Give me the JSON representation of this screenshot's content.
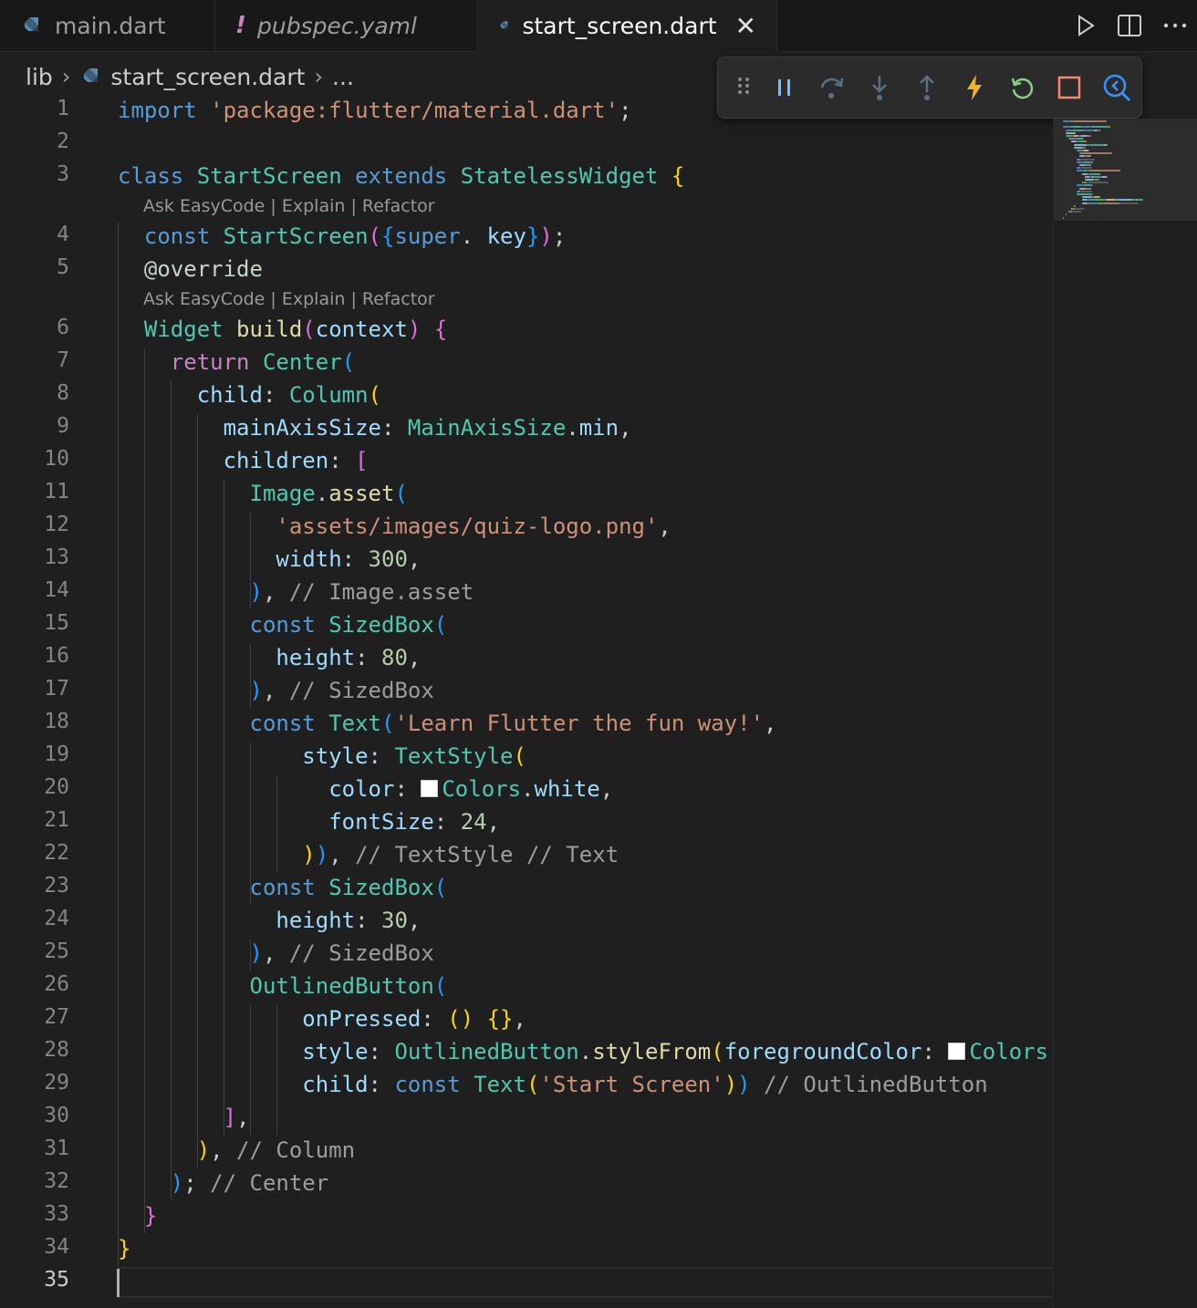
{
  "tabs": [
    {
      "label": "main.dart",
      "active": false,
      "icon": "dart-icon"
    },
    {
      "label": "pubspec.yaml",
      "active": false,
      "icon": "warning-exclamation-icon",
      "mark": "!"
    },
    {
      "label": "start_screen.dart",
      "active": true,
      "icon": "dart-icon"
    }
  ],
  "breadcrumb": {
    "folder": "lib",
    "file": "start_screen.dart",
    "ellipsis": "..."
  },
  "debug_toolbar": {
    "icons": [
      "drag-handle-icon",
      "pause-icon",
      "step-over-icon",
      "step-into-icon",
      "step-out-icon",
      "hot-reload-icon",
      "restart-icon",
      "stop-icon",
      "devtools-inspector-icon"
    ]
  },
  "editor": {
    "current_line": 35,
    "codelens_1": "Ask EasyCode | Explain | Refactor",
    "codelens_2": "Ask EasyCode | Explain | Refactor",
    "line_numbers": [
      "1",
      "2",
      "3",
      "4",
      "5",
      "6",
      "7",
      "8",
      "9",
      "10",
      "11",
      "12",
      "13",
      "14",
      "15",
      "16",
      "17",
      "18",
      "19",
      "20",
      "21",
      "22",
      "23",
      "24",
      "25",
      "26",
      "27",
      "28",
      "29",
      "30",
      "31",
      "32",
      "33",
      "34",
      "35"
    ],
    "lines": [
      [
        [
          "kw",
          "import"
        ],
        [
          "",
          "' "
        ],
        [
          "str",
          "'package:flutter/material.dart'"
        ],
        [
          "",
          ";"
        ]
      ],
      [],
      [
        [
          "kw",
          "class "
        ],
        [
          "cls",
          "StartScreen "
        ],
        [
          "kw",
          "extends "
        ],
        [
          "cls",
          "StatelessWidget "
        ],
        [
          "b1",
          "{"
        ]
      ],
      [
        [
          "kw",
          "const "
        ],
        [
          "cls",
          "StartScreen"
        ],
        [
          "b2",
          "("
        ],
        [
          "b3",
          "{"
        ],
        [
          "kw",
          "super"
        ],
        [
          "",
          ". "
        ],
        [
          "prop",
          "key"
        ],
        [
          "b3",
          "}"
        ],
        [
          "b2",
          ")"
        ],
        [
          "",
          ";"
        ]
      ],
      [
        [
          "ann",
          "@override"
        ]
      ],
      [
        [
          "cls",
          "Widget "
        ],
        [
          "fn",
          "build"
        ],
        [
          "b2",
          "("
        ],
        [
          "prop",
          "context"
        ],
        [
          "b2",
          ")"
        ],
        [
          "",
          " "
        ],
        [
          "b2",
          "{"
        ]
      ],
      [
        [
          "ctl",
          "return "
        ],
        [
          "cls",
          "Center"
        ],
        [
          "b3",
          "("
        ]
      ],
      [
        [
          "prop",
          "child"
        ],
        [
          "",
          ": "
        ],
        [
          "cls",
          "Column"
        ],
        [
          "b1",
          "("
        ]
      ],
      [
        [
          "prop",
          "mainAxisSize"
        ],
        [
          "",
          ": "
        ],
        [
          "cls",
          "MainAxisSize"
        ],
        [
          "",
          "."
        ],
        [
          "prop",
          "min"
        ],
        [
          "",
          ","
        ]
      ],
      [
        [
          "prop",
          "children"
        ],
        [
          "",
          ": "
        ],
        [
          "b2",
          "["
        ]
      ],
      [
        [
          "cls",
          "Image"
        ],
        [
          "",
          "."
        ],
        [
          "fn",
          "asset"
        ],
        [
          "b3",
          "("
        ]
      ],
      [
        [
          "str",
          "'assets/images/quiz-logo.png'"
        ],
        [
          "",
          ","
        ]
      ],
      [
        [
          "prop",
          "width"
        ],
        [
          "",
          ": "
        ],
        [
          "num",
          "300"
        ],
        [
          "",
          ","
        ]
      ],
      [
        [
          "b3",
          ")"
        ],
        [
          "",
          ", "
        ],
        [
          "cmt",
          "// Image.asset"
        ]
      ],
      [
        [
          "kw",
          "const "
        ],
        [
          "cls",
          "SizedBox"
        ],
        [
          "b3",
          "("
        ]
      ],
      [
        [
          "prop",
          "height"
        ],
        [
          "",
          ": "
        ],
        [
          "num",
          "80"
        ],
        [
          "",
          ","
        ]
      ],
      [
        [
          "b3",
          ")"
        ],
        [
          "",
          ", "
        ],
        [
          "cmt",
          "// SizedBox"
        ]
      ],
      [
        [
          "kw",
          "const "
        ],
        [
          "cls",
          "Text"
        ],
        [
          "b3",
          "("
        ],
        [
          "str",
          "'Learn Flutter the fun way!'"
        ],
        [
          "",
          ","
        ]
      ],
      [
        [
          "prop",
          "style"
        ],
        [
          "",
          ": "
        ],
        [
          "cls",
          "TextStyle"
        ],
        [
          "b1",
          "("
        ]
      ],
      [
        [
          "prop",
          "color"
        ],
        [
          "",
          ": "
        ],
        [
          "swatch",
          ""
        ],
        [
          "cls",
          "Colors"
        ],
        [
          "",
          "."
        ],
        [
          "prop",
          "white"
        ],
        [
          "",
          ","
        ]
      ],
      [
        [
          "prop",
          "fontSize"
        ],
        [
          "",
          ": "
        ],
        [
          "num",
          "24"
        ],
        [
          "",
          ","
        ]
      ],
      [
        [
          "b1",
          ")"
        ],
        [
          "b3",
          ")"
        ],
        [
          "",
          ", "
        ],
        [
          "cmt",
          "// TextStyle // Text"
        ]
      ],
      [
        [
          "kw",
          "const "
        ],
        [
          "cls",
          "SizedBox"
        ],
        [
          "b3",
          "("
        ]
      ],
      [
        [
          "prop",
          "height"
        ],
        [
          "",
          ": "
        ],
        [
          "num",
          "30"
        ],
        [
          "",
          ","
        ]
      ],
      [
        [
          "b3",
          ")"
        ],
        [
          "",
          ", "
        ],
        [
          "cmt",
          "// SizedBox"
        ]
      ],
      [
        [
          "cls",
          "OutlinedButton"
        ],
        [
          "b3",
          "("
        ]
      ],
      [
        [
          "prop",
          "onPressed"
        ],
        [
          "",
          ": "
        ],
        [
          "b1",
          "() {}"
        ],
        [
          "",
          ","
        ]
      ],
      [
        [
          "prop",
          "style"
        ],
        [
          "",
          ": "
        ],
        [
          "cls",
          "OutlinedButton"
        ],
        [
          "",
          "."
        ],
        [
          "fn",
          "styleFrom"
        ],
        [
          "b1",
          "("
        ],
        [
          "prop",
          "foregroundColor"
        ],
        [
          "",
          ": "
        ],
        [
          "swatch",
          ""
        ],
        [
          "cls",
          "Colors"
        ]
      ],
      [
        [
          "prop",
          "child"
        ],
        [
          "",
          ": "
        ],
        [
          "kw",
          "const "
        ],
        [
          "cls",
          "Text"
        ],
        [
          "b1",
          "("
        ],
        [
          "str",
          "'Start Screen'"
        ],
        [
          "b1",
          ")"
        ],
        [
          "b3",
          ")"
        ],
        [
          "",
          " "
        ],
        [
          "cmt",
          "// OutlinedButton"
        ]
      ],
      [
        [
          "b2",
          "]"
        ],
        [
          "",
          ","
        ]
      ],
      [
        [
          "b1",
          ")"
        ],
        [
          "",
          ", "
        ],
        [
          "cmt",
          "// Column"
        ]
      ],
      [
        [
          "b3",
          ")"
        ],
        [
          "",
          "; "
        ],
        [
          "cmt",
          "// Center"
        ]
      ],
      [
        [
          "b2",
          "}"
        ]
      ],
      [
        [
          "b1",
          "}"
        ]
      ],
      []
    ]
  },
  "colors": {
    "background": "#1f1f1f",
    "keyword": "#569cd6",
    "control": "#c586c0",
    "class": "#4ec9b0",
    "function": "#dcdcaa",
    "string": "#ce9178",
    "number": "#b5cea8",
    "property": "#9cdcfe",
    "comment": "#9d9d9d"
  }
}
